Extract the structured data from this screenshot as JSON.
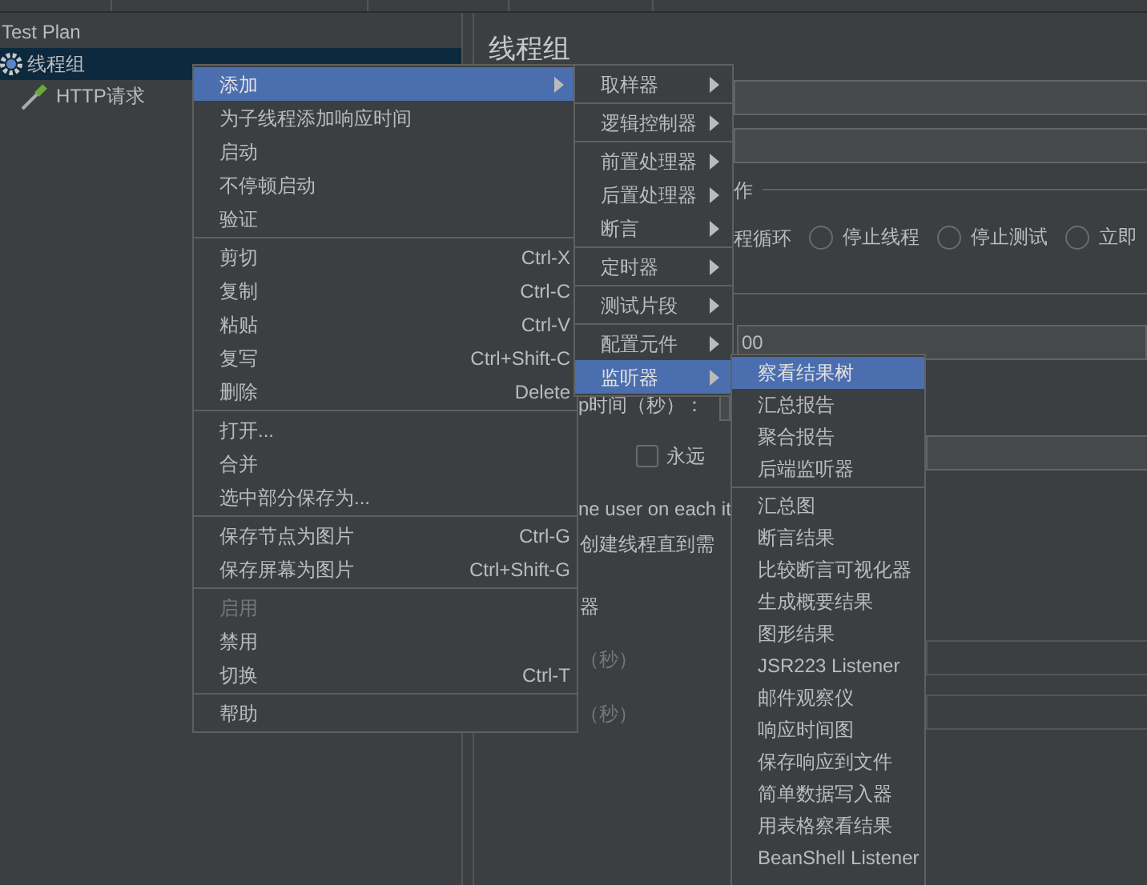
{
  "tree": [
    {
      "label": "Test Plan",
      "selected": false,
      "children": [
        {
          "label": "线程组",
          "selected": true,
          "children": [
            {
              "label": "HTTP请求",
              "selected": false
            }
          ]
        }
      ]
    }
  ],
  "form": {
    "title": "线程组",
    "group_label": "作",
    "loop_fragment": "程循环",
    "radios": [
      {
        "label": "停止线程",
        "selected": false
      },
      {
        "label": "停止测试",
        "selected": false
      },
      {
        "label": "立即",
        "selected": false
      }
    ],
    "field_value": "00",
    "ramp_label": "p时间（秒）：",
    "forever": {
      "label": "永远",
      "checked": false
    },
    "same_user_fragment": "ne user on each it",
    "delay_fragment": "创建线程直到需",
    "scheduler_fragment": "器",
    "duration_label": "（秒）",
    "startup_label": "（秒）"
  },
  "context_menu": [
    {
      "kind": "item",
      "label": "添加",
      "selected": true,
      "submenu": true
    },
    {
      "kind": "item",
      "label": "为子线程添加响应时间"
    },
    {
      "kind": "item",
      "label": "启动"
    },
    {
      "kind": "item",
      "label": "不停顿启动"
    },
    {
      "kind": "item",
      "label": "验证"
    },
    {
      "kind": "separator"
    },
    {
      "kind": "item",
      "label": "剪切",
      "shortcut": "Ctrl-X"
    },
    {
      "kind": "item",
      "label": "复制",
      "shortcut": "Ctrl-C"
    },
    {
      "kind": "item",
      "label": "粘贴",
      "shortcut": "Ctrl-V"
    },
    {
      "kind": "item",
      "label": "复写",
      "shortcut": "Ctrl+Shift-C"
    },
    {
      "kind": "item",
      "label": "删除",
      "shortcut": "Delete"
    },
    {
      "kind": "separator"
    },
    {
      "kind": "item",
      "label": "打开..."
    },
    {
      "kind": "item",
      "label": "合并"
    },
    {
      "kind": "item",
      "label": "选中部分保存为..."
    },
    {
      "kind": "separator"
    },
    {
      "kind": "item",
      "label": "保存节点为图片",
      "shortcut": "Ctrl-G"
    },
    {
      "kind": "item",
      "label": "保存屏幕为图片",
      "shortcut": "Ctrl+Shift-G"
    },
    {
      "kind": "separator"
    },
    {
      "kind": "item",
      "label": "启用",
      "disabled": true
    },
    {
      "kind": "item",
      "label": "禁用"
    },
    {
      "kind": "item",
      "label": "切换",
      "shortcut": "Ctrl-T"
    },
    {
      "kind": "separator"
    },
    {
      "kind": "item",
      "label": "帮助"
    }
  ],
  "add_submenu": [
    {
      "kind": "item",
      "label": "取样器",
      "submenu": true
    },
    {
      "kind": "separator"
    },
    {
      "kind": "item",
      "label": "逻辑控制器",
      "submenu": true
    },
    {
      "kind": "separator"
    },
    {
      "kind": "item",
      "label": "前置处理器",
      "submenu": true
    },
    {
      "kind": "item",
      "label": "后置处理器",
      "submenu": true
    },
    {
      "kind": "item",
      "label": "断言",
      "submenu": true
    },
    {
      "kind": "separator"
    },
    {
      "kind": "item",
      "label": "定时器",
      "submenu": true
    },
    {
      "kind": "separator"
    },
    {
      "kind": "item",
      "label": "测试片段",
      "submenu": true
    },
    {
      "kind": "separator"
    },
    {
      "kind": "item",
      "label": "配置元件",
      "submenu": true
    },
    {
      "kind": "item",
      "label": "监听器",
      "submenu": true,
      "selected": true
    }
  ],
  "listener_submenu": [
    {
      "kind": "item",
      "label": "察看结果树",
      "selected": true
    },
    {
      "kind": "item",
      "label": "汇总报告"
    },
    {
      "kind": "item",
      "label": "聚合报告"
    },
    {
      "kind": "item",
      "label": "后端监听器"
    },
    {
      "kind": "separator"
    },
    {
      "kind": "item",
      "label": "汇总图"
    },
    {
      "kind": "item",
      "label": "断言结果"
    },
    {
      "kind": "item",
      "label": "比较断言可视化器"
    },
    {
      "kind": "item",
      "label": "生成概要结果"
    },
    {
      "kind": "item",
      "label": "图形结果"
    },
    {
      "kind": "item",
      "label": "JSR223 Listener"
    },
    {
      "kind": "item",
      "label": "邮件观察仪"
    },
    {
      "kind": "item",
      "label": "响应时间图"
    },
    {
      "kind": "item",
      "label": "保存响应到文件"
    },
    {
      "kind": "item",
      "label": "简单数据写入器"
    },
    {
      "kind": "item",
      "label": "用表格察看结果"
    },
    {
      "kind": "item",
      "label": "BeanShell Listener"
    }
  ]
}
